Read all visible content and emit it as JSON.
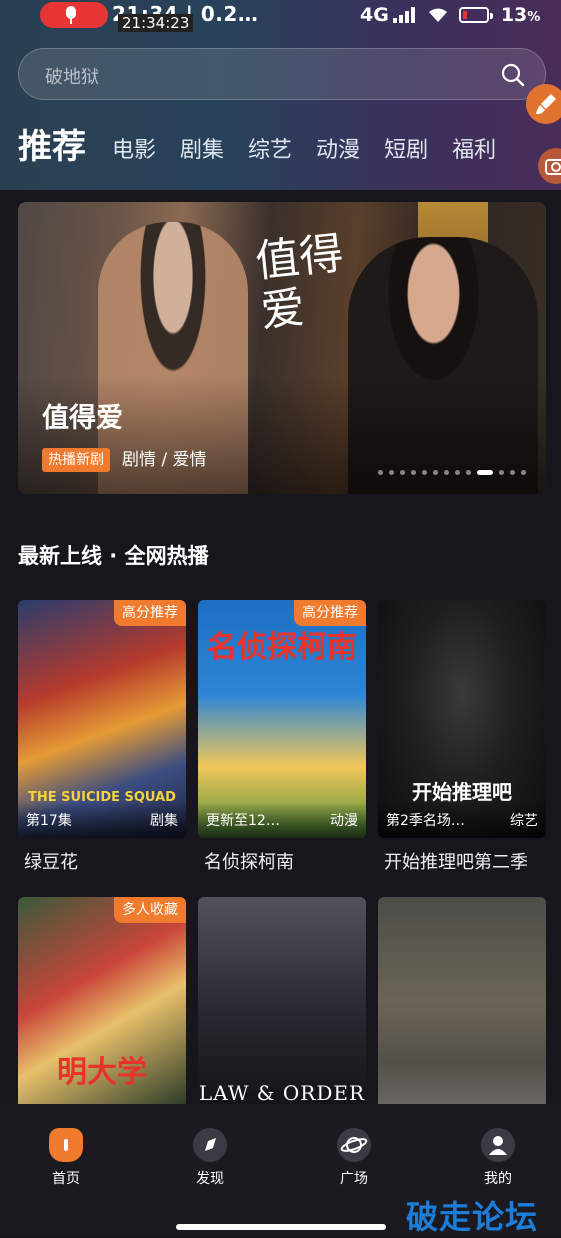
{
  "status_bar": {
    "time": "21:34 | 0.2…",
    "time_overlay": "21:34:23",
    "network": "4G",
    "battery": "13"
  },
  "search": {
    "placeholder": "破地狱"
  },
  "tabs": [
    {
      "label": "推荐",
      "active": true
    },
    {
      "label": "电影"
    },
    {
      "label": "剧集"
    },
    {
      "label": "综艺"
    },
    {
      "label": "动漫"
    },
    {
      "label": "短剧"
    },
    {
      "label": "福利"
    }
  ],
  "banner": {
    "poster_title_art": "值得爱",
    "title": "值得爱",
    "tag": "热播新剧",
    "genre": "剧情 / 爱情",
    "page_count": 13,
    "current_page": 10
  },
  "section": {
    "title": "最新上线 · 全网热播"
  },
  "cards": [
    {
      "name": "绿豆花",
      "badge": "高分推荐",
      "episode": "第17集",
      "category": "剧集",
      "poster_text": "THE SUICIDE SQUAD"
    },
    {
      "name": "名侦探柯南",
      "badge": "高分推荐",
      "episode": "更新至12…",
      "category": "动漫",
      "poster_text": "名侦探柯南"
    },
    {
      "name": "开始推理吧第二季",
      "badge": "",
      "episode": "第2季名场…",
      "category": "综艺",
      "poster_text": "开始推理吧"
    },
    {
      "name": "",
      "badge": "多人收藏",
      "episode": "",
      "category": "",
      "poster_text": "明大学"
    },
    {
      "name": "",
      "badge": "",
      "episode": "",
      "category": "",
      "poster_text": "LAW & ORDER"
    },
    {
      "name": "",
      "badge": "",
      "episode": "",
      "category": "",
      "poster_text": ""
    }
  ],
  "bottom_nav": [
    {
      "label": "首页",
      "icon": "home-icon",
      "active": true
    },
    {
      "label": "发现",
      "icon": "compass-icon"
    },
    {
      "label": "广场",
      "icon": "planet-icon"
    },
    {
      "label": "我的",
      "icon": "user-icon"
    }
  ],
  "watermark": "破走论坛",
  "colors": {
    "accent": "#f07a2e",
    "background": "#17161c"
  }
}
